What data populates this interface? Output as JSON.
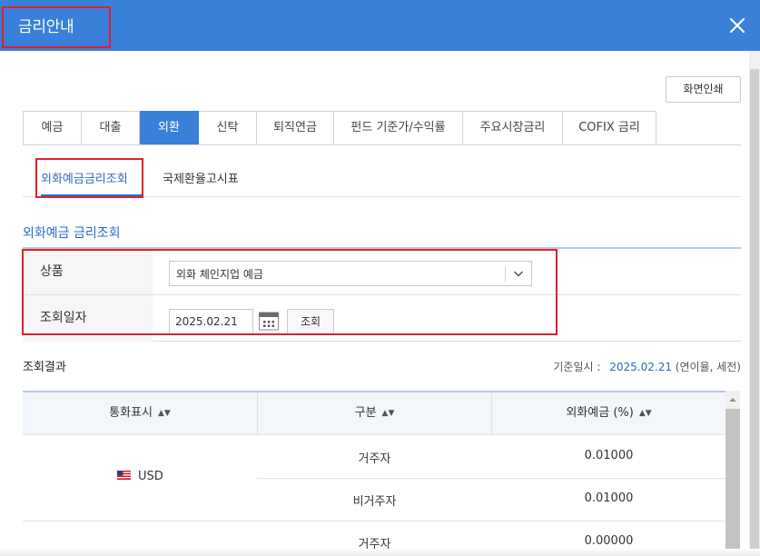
{
  "window": {
    "title": "금리안내",
    "close_icon": "close-icon",
    "title_bg": "#3a7fd9",
    "accent": "#2b6cc4",
    "highlight_color": "#e0202a"
  },
  "toolbar": {
    "print_label": "화면인쇄"
  },
  "tabs": [
    {
      "label": "예금",
      "active": false
    },
    {
      "label": "대출",
      "active": false
    },
    {
      "label": "외환",
      "active": true
    },
    {
      "label": "신탁",
      "active": false
    },
    {
      "label": "퇴직연금",
      "active": false
    },
    {
      "label": "펀드 기준가/수익률",
      "active": false
    },
    {
      "label": "주요시장금리",
      "active": false
    },
    {
      "label": "COFIX 금리",
      "active": false
    }
  ],
  "subtabs": [
    {
      "label": "외화예금금리조회",
      "active": true
    },
    {
      "label": "국제환율고시표",
      "active": false
    }
  ],
  "section_title": "외화예금 금리조회",
  "form": {
    "product_label": "상품",
    "product_value": "외화 체인지업 예금",
    "date_label": "조회일자",
    "date_value": "2025.02.21",
    "search_label": "조회"
  },
  "result": {
    "title": "조회결과",
    "base_label": "기준일시 :",
    "base_date": "2025.02.21",
    "base_note": "(연이율, 세전)"
  },
  "table": {
    "headers": [
      "통화표시",
      "구분",
      "외화예금 (%)"
    ],
    "sort_icon": "sort-icon",
    "rows": [
      {
        "currency": "USD",
        "flag": "us-flag-icon",
        "entries": [
          {
            "type": "거주자",
            "rate": "0.01000"
          },
          {
            "type": "비거주자",
            "rate": "0.01000"
          }
        ]
      },
      {
        "currency": "",
        "entries": [
          {
            "type": "거주자",
            "rate": "0.00000"
          }
        ]
      }
    ]
  }
}
